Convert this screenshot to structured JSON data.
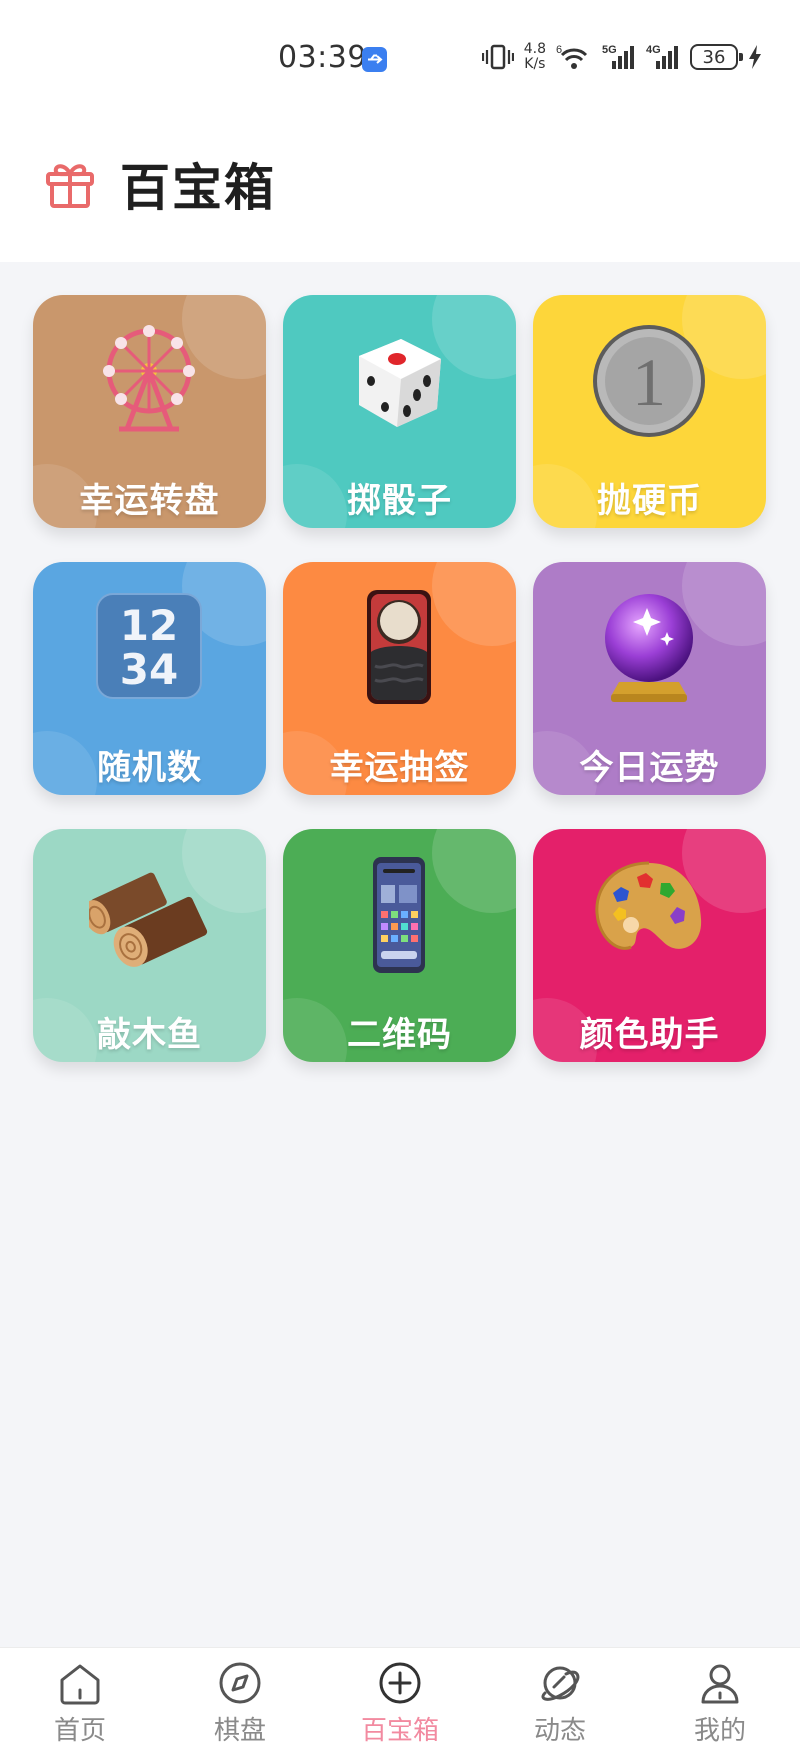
{
  "status_bar": {
    "time": "03:39",
    "net_speed_value": "4.8",
    "net_speed_unit": "K/s",
    "signal_5g": "5G",
    "signal_4g": "4G",
    "wifi_tag": "6",
    "battery": "36"
  },
  "header": {
    "title": "百宝箱",
    "icon": "gift-icon",
    "icon_color": "#e96a6a"
  },
  "tools": [
    {
      "label": "幸运转盘",
      "icon": "ferris-wheel-icon",
      "color": "#c9976c"
    },
    {
      "label": "掷骰子",
      "icon": "dice-icon",
      "color": "#4fc9c0"
    },
    {
      "label": "抛硬币",
      "icon": "coin-icon",
      "color": "#fdd63a"
    },
    {
      "label": "随机数",
      "icon": "number-block-icon",
      "color": "#5aa6e1"
    },
    {
      "label": "幸运抽签",
      "icon": "fortune-stick-icon",
      "color": "#fd8a42"
    },
    {
      "label": "今日运势",
      "icon": "crystal-ball-icon",
      "color": "#ae7cc7"
    },
    {
      "label": "敲木鱼",
      "icon": "wood-log-icon",
      "color": "#9cd8c5"
    },
    {
      "label": "二维码",
      "icon": "phone-icon",
      "color": "#4cad55"
    },
    {
      "label": "颜色助手",
      "icon": "palette-icon",
      "color": "#e4206a"
    }
  ],
  "number_block_text": {
    "line1": "12",
    "line2": "34"
  },
  "coin_text": "1",
  "bottom_nav": [
    {
      "label": "首页",
      "icon": "home-icon"
    },
    {
      "label": "棋盘",
      "icon": "compass-icon"
    },
    {
      "label": "百宝箱",
      "icon": "plus-circle-icon",
      "active": true
    },
    {
      "label": "动态",
      "icon": "planet-icon"
    },
    {
      "label": "我的",
      "icon": "person-icon"
    }
  ],
  "colors": {
    "nav_active": "#f28aa0",
    "nav_inactive": "#8a8a8a",
    "page_bg": "#f4f5f8"
  }
}
